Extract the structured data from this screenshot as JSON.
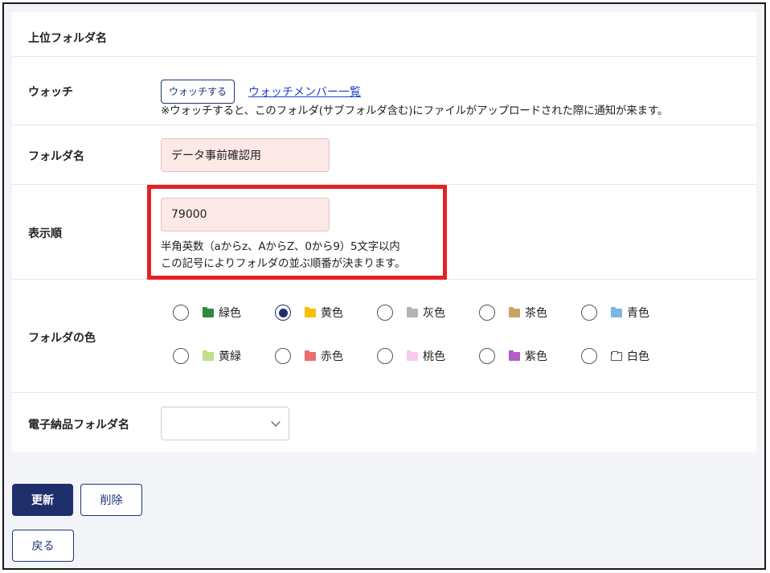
{
  "labels": {
    "parent_folder": "上位フォルダ名",
    "watch": "ウォッチ",
    "folder_name": "フォルダ名",
    "display_order": "表示順",
    "folder_color": "フォルダの色",
    "delivery_folder": "電子納品フォルダ名"
  },
  "watch": {
    "button_label": "ウォッチする",
    "members_link": "ウォッチメンバー一覧",
    "note": "※ウォッチすると、このフォルダ(サブフォルダ含む)にファイルがアップロードされた際に通知が来ます。"
  },
  "folder_name": {
    "value": "データ事前確認用"
  },
  "display_order": {
    "value": "79000",
    "help_line1": "半角英数（aからz、AからZ、0から9）5文字以内",
    "help_line2": "この記号によりフォルダの並ぶ順番が決まります。"
  },
  "folder_colors": {
    "selected": "黄色",
    "options": [
      {
        "label": "緑色",
        "color": "#2e8b3e"
      },
      {
        "label": "黄色",
        "color": "#f5c10a"
      },
      {
        "label": "灰色",
        "color": "#b4b4b4"
      },
      {
        "label": "茶色",
        "color": "#c9a466"
      },
      {
        "label": "青色",
        "color": "#7ab7e0"
      },
      {
        "label": "黄緑",
        "color": "#c3de8c"
      },
      {
        "label": "赤色",
        "color": "#ee6b6b"
      },
      {
        "label": "桃色",
        "color": "#f9c8f0"
      },
      {
        "label": "紫色",
        "color": "#b45cc8"
      },
      {
        "label": "白色",
        "color": "#ffffff"
      }
    ]
  },
  "delivery_folder": {
    "selected": ""
  },
  "actions": {
    "update": "更新",
    "delete": "削除",
    "back": "戻る"
  },
  "colors": {
    "primary": "#1e2f6b",
    "link": "#1a44c8",
    "input_bg": "#fde8e8",
    "highlight": "#e52222",
    "page_bg": "#f3f4f8"
  }
}
